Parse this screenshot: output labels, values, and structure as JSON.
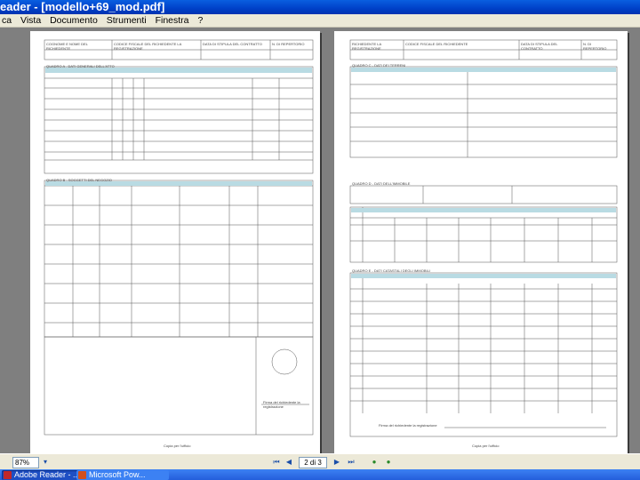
{
  "window": {
    "title": "eader - [modello+69_mod.pdf]"
  },
  "menu": [
    "ca",
    "Vista",
    "Documento",
    "Strumenti",
    "Finestra",
    "?"
  ],
  "pages": {
    "left": {
      "header_labels": [
        "COGNOME E NOME DEL RICHIEDENTE",
        "CODICE FISCALE DEL RICHIEDENTE LA REGISTRAZIONE",
        "DATA DI STIPULA DEL CONTRATTO",
        "N. DI REPERTORIO"
      ],
      "section_a": "QUADRO A - DATI GENERALI DELL'ATTO",
      "section_b": "QUADRO B - SOGGETTI DEL NEGOZIO",
      "stamp_caption": "Firma del richiedente la registrazione",
      "footer": "Copia per l'ufficio"
    },
    "right": {
      "header_labels": [
        "RICHIEDENTE LA REGISTRAZIONE",
        "CODICE FISCALE DEL RICHIEDENTE",
        "DATA DI STIPULA DEL CONTRATTO",
        "N. DI REPERTORIO"
      ],
      "section_c": "QUADRO C - DATI DEI TERRENI",
      "section_d": "QUADRO D - DATI DELL'IMMOBILE",
      "section_e": "QUADRO E - DATI CATASTALI DEGLI IMMOBILI",
      "footer_sign": "Firma del richiedente la registrazione",
      "footer": "Copia per l'ufficio"
    }
  },
  "status": {
    "zoom": "87%",
    "page_indicator": "2 di 3"
  },
  "taskbar": [
    {
      "label": "Adobe Reader - ...",
      "color": "#c0282a"
    },
    {
      "label": "Microsoft Pow...",
      "color": "#d2501e"
    }
  ]
}
